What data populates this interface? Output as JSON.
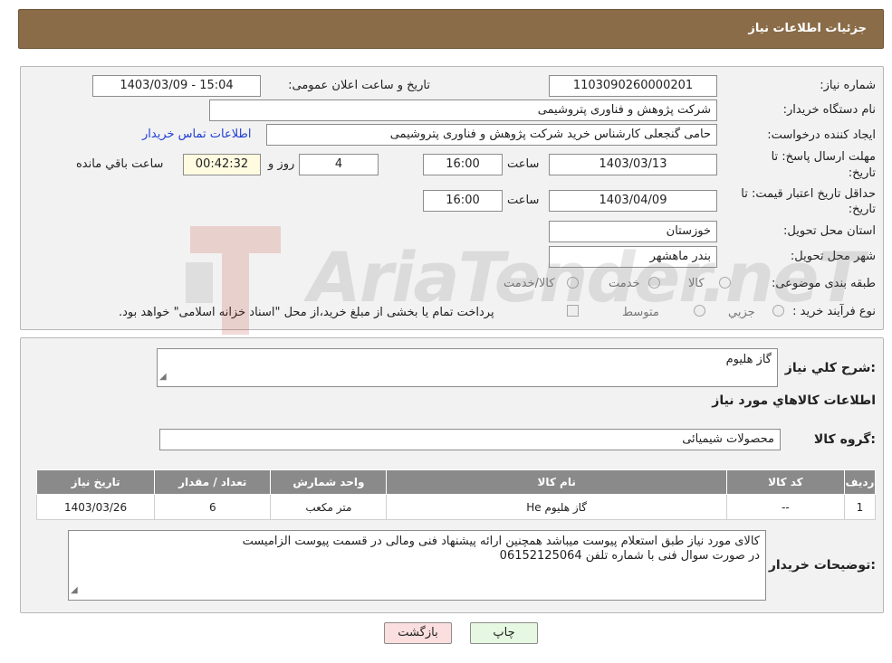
{
  "header": {
    "title": "جزئیات اطلاعات نیاز"
  },
  "need_info": {
    "need_number_label": "شماره نیاز:",
    "need_number": "1103090260000201",
    "announce_label": "تاریخ و ساعت اعلان عمومی:",
    "announce_value": "1403/03/09 - 15:04",
    "buyer_org_label": "نام دستگاه خریدار:",
    "buyer_org": "شرکت پژوهش و فناوری پتروشیمی",
    "creator_label": "ایجاد کننده درخواست:",
    "creator": "حامی گنجعلی کارشناس خرید شرکت پژوهش و فناوری پتروشیمی",
    "contact_link": "اطلاعات تماس خریدار",
    "deadline_label_1": "مهلت ارسال پاسخ: تا",
    "deadline_label_2": "تاریخ:",
    "deadline_date": "1403/03/13",
    "time_label": "ساعت",
    "deadline_time": "16:00",
    "days_value": "4",
    "days_label": "روز و",
    "remaining_time": "00:42:32",
    "remaining_label": "ساعت باقي مانده",
    "validity_label_1": "حداقل تاریخ اعتبار قیمت: تا",
    "validity_label_2": "تاریخ:",
    "validity_date": "1403/04/09",
    "validity_time": "16:00",
    "province_label": "استان محل تحویل:",
    "province": "خوزستان",
    "city_label": "شهر محل تحویل:",
    "city": "بندر ماهشهر",
    "category_label": "طبقه بندی موضوعی:",
    "category_options": [
      "کالا",
      "خدمت",
      "کالا/خدمت"
    ],
    "process_label": "نوع فرآیند خرید :",
    "process_options": [
      "جزیي",
      "متوسط"
    ],
    "payment_note": "پرداخت تمام یا بخشی از مبلغ خرید،از محل \"اسناد خزانه اسلامی\" خواهد بود."
  },
  "details": {
    "summary_label": "شرح كلي نياز:",
    "summary_value": "گاز هلیوم",
    "goods_info_title": "اطلاعات كالاهاي مورد نياز",
    "goods_group_label": "گروه کالا:",
    "goods_group_value": "محصولات شیمیائی",
    "table": {
      "headers": [
        "ردیف",
        "کد کالا",
        "نام کالا",
        "واحد شمارش",
        "تعداد / مقدار",
        "تاریخ نیاز"
      ],
      "rows": [
        [
          "1",
          "--",
          "گاز هلیوم He",
          "متر مکعب",
          "6",
          "1403/03/26"
        ]
      ]
    },
    "buyer_notes_label": "توضیحات خریدار:",
    "buyer_notes_line1": "کالای مورد نیاز طبق استعلام پیوست میباشد همچنین ارائه پیشنهاد فنی ومالی در قسمت پیوست الزامیست",
    "buyer_notes_line2": "در صورت سوال فنی با شماره تلفن 06152125064"
  },
  "buttons": {
    "print": "چاپ",
    "back": "بازگشت"
  },
  "watermark": {
    "text": "AriaTender.neT"
  }
}
